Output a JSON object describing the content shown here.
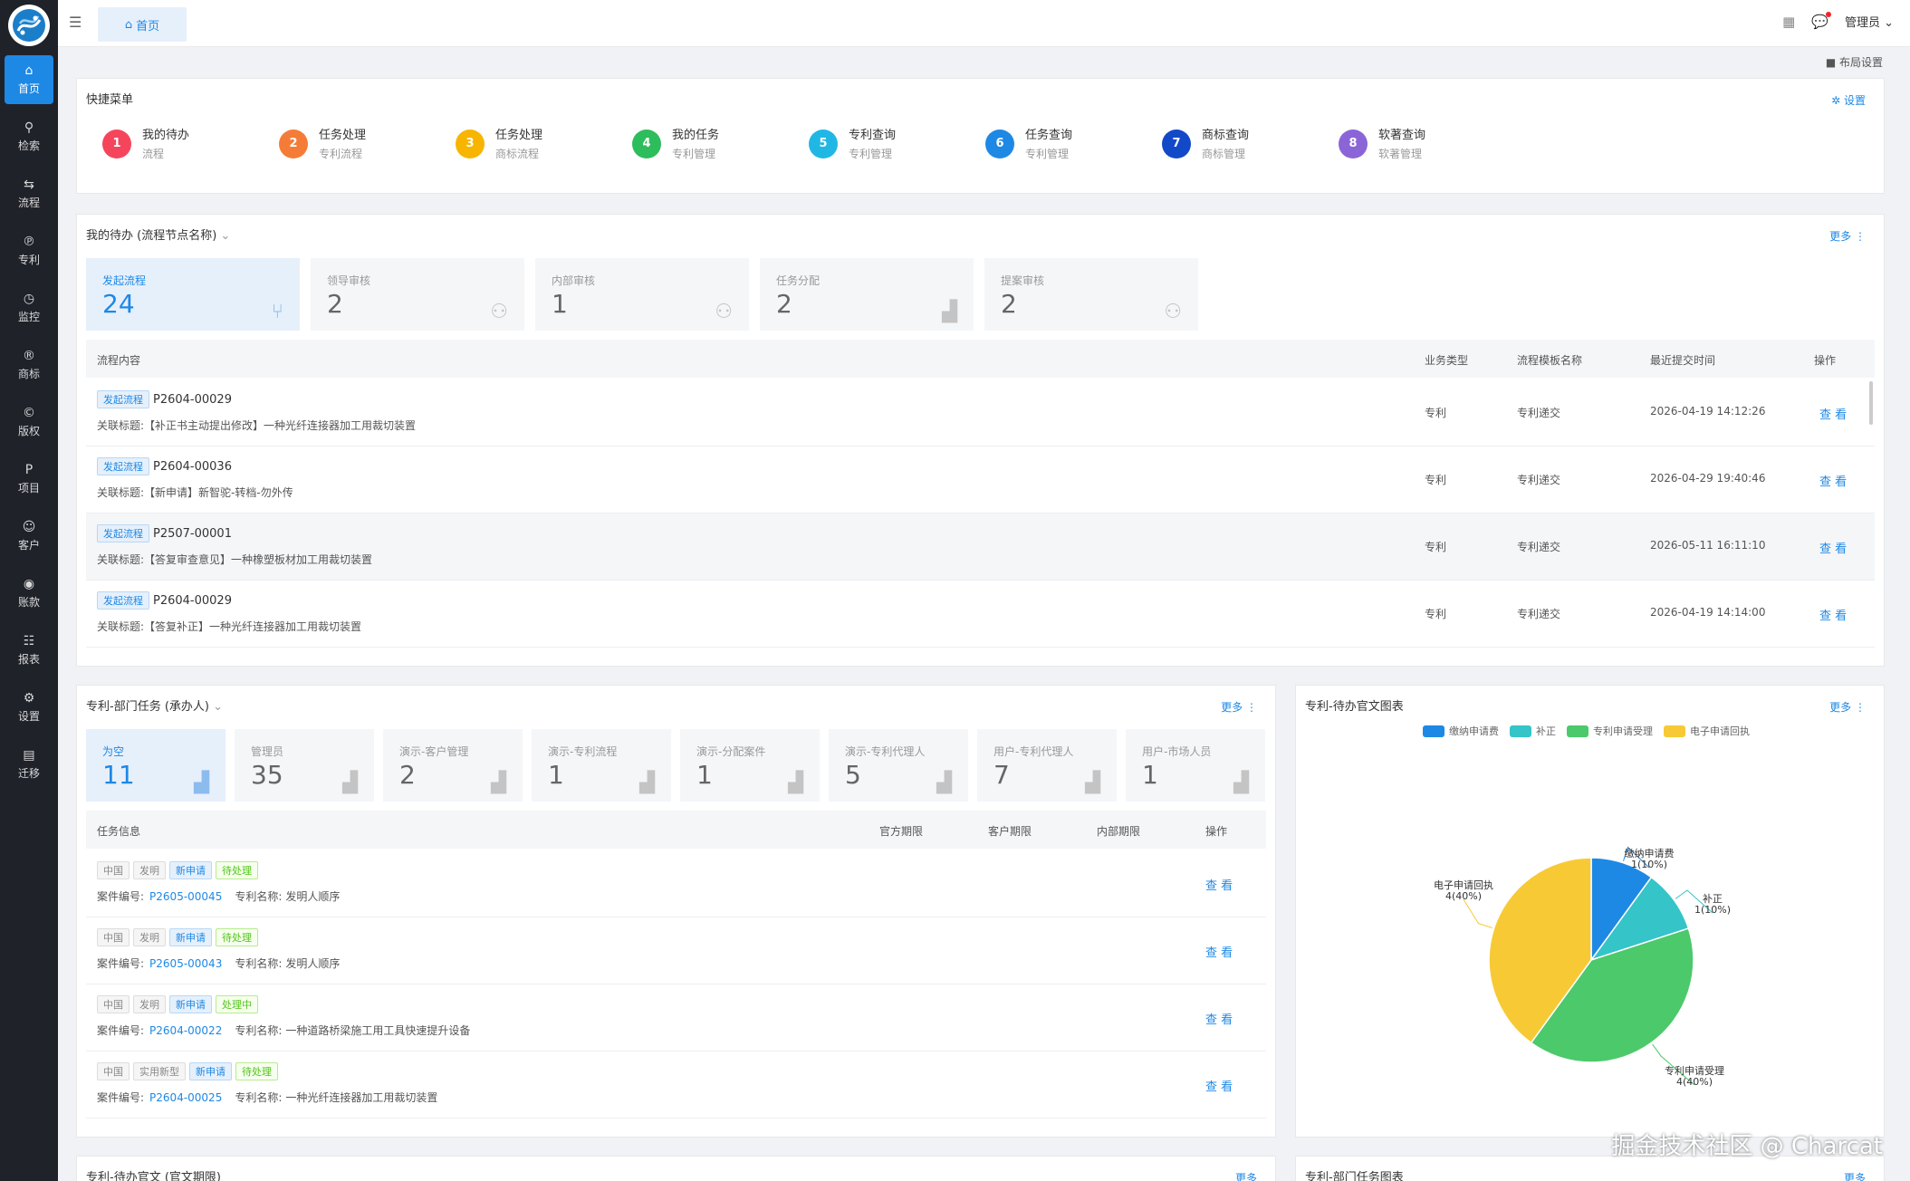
{
  "sidebar": {
    "items": [
      {
        "label": "首页",
        "icon": "home-icon"
      },
      {
        "label": "检索",
        "icon": "search-icon"
      },
      {
        "label": "流程",
        "icon": "flow-icon"
      },
      {
        "label": "专利",
        "icon": "patent-icon"
      },
      {
        "label": "监控",
        "icon": "clock-icon"
      },
      {
        "label": "商标",
        "icon": "trademark-icon"
      },
      {
        "label": "版权",
        "icon": "copyright-icon"
      },
      {
        "label": "项目",
        "icon": "project-icon"
      },
      {
        "label": "客户",
        "icon": "user-icon"
      },
      {
        "label": "账款",
        "icon": "money-icon"
      },
      {
        "label": "报表",
        "icon": "report-icon"
      },
      {
        "label": "设置",
        "icon": "gear-icon"
      },
      {
        "label": "迁移",
        "icon": "migrate-icon"
      }
    ]
  },
  "topbar": {
    "tab": "首页",
    "user": "管理员"
  },
  "layout_link": "布局设置",
  "quick": {
    "title": "快捷菜单",
    "settings": "设置",
    "items": [
      {
        "n": "1",
        "t": "我的待办",
        "s": "流程",
        "c": "#f5455c"
      },
      {
        "n": "2",
        "t": "任务处理",
        "s": "专利流程",
        "c": "#f57c37"
      },
      {
        "n": "3",
        "t": "任务处理",
        "s": "商标流程",
        "c": "#f7b500"
      },
      {
        "n": "4",
        "t": "我的任务",
        "s": "专利管理",
        "c": "#2dbd5c"
      },
      {
        "n": "5",
        "t": "专利查询",
        "s": "专利管理",
        "c": "#21b7e5"
      },
      {
        "n": "6",
        "t": "任务查询",
        "s": "专利管理",
        "c": "#1e88e5"
      },
      {
        "n": "7",
        "t": "商标查询",
        "s": "商标管理",
        "c": "#1249c9"
      },
      {
        "n": "8",
        "t": "软著查询",
        "s": "软著管理",
        "c": "#8b65d8"
      }
    ]
  },
  "todo": {
    "title": "我的待办 (流程节点名称)",
    "more": "更多",
    "stats": [
      {
        "l": "发起流程",
        "v": "24"
      },
      {
        "l": "领导审核",
        "v": "2"
      },
      {
        "l": "内部审核",
        "v": "1"
      },
      {
        "l": "任务分配",
        "v": "2"
      },
      {
        "l": "提案审核",
        "v": "2"
      }
    ],
    "headers": [
      "流程内容",
      "业务类型",
      "流程模板名称",
      "最近提交时间",
      "操作"
    ],
    "rows": [
      {
        "tag": "发起流程",
        "code": "P2604-00029",
        "label": "关联标题:",
        "title": "【补正书主动提出修改】一种光纤连接器加工用裁切装置",
        "type": "专利",
        "tpl": "专利递交",
        "time": "2026-04-19 14:12:26",
        "op": "查 看"
      },
      {
        "tag": "发起流程",
        "code": "P2604-00036",
        "label": "关联标题:",
        "title": "【新申请】新智驼-转档-勿外传",
        "type": "专利",
        "tpl": "专利递交",
        "time": "2026-04-29 19:40:46",
        "op": "查 看"
      },
      {
        "tag": "发起流程",
        "code": "P2507-00001",
        "label": "关联标题:",
        "title": "【答复审查意见】一种橡塑板材加工用裁切装置",
        "type": "专利",
        "tpl": "专利递交",
        "time": "2026-05-11 16:11:10",
        "op": "查 看"
      },
      {
        "tag": "发起流程",
        "code": "P2604-00029",
        "label": "关联标题:",
        "title": "【答复补正】一种光纤连接器加工用裁切装置",
        "type": "专利",
        "tpl": "专利递交",
        "time": "2026-04-19 14:14:00",
        "op": "查 看"
      }
    ]
  },
  "dept": {
    "title": "专利-部门任务 (承办人)",
    "more": "更多",
    "stats": [
      {
        "l": "为空",
        "v": "11"
      },
      {
        "l": "管理员",
        "v": "35"
      },
      {
        "l": "演示-客户管理",
        "v": "2"
      },
      {
        "l": "演示-专利流程",
        "v": "1"
      },
      {
        "l": "演示-分配案件",
        "v": "1"
      },
      {
        "l": "演示-专利代理人",
        "v": "5"
      },
      {
        "l": "用户-专利代理人",
        "v": "7"
      },
      {
        "l": "用户-市场人员",
        "v": "1"
      }
    ],
    "headers": [
      "任务信息",
      "官方期限",
      "客户期限",
      "内部期限",
      "操作"
    ],
    "case_label": "案件编号:",
    "name_label": "专利名称:",
    "rows": [
      {
        "tags": [
          "中国",
          "发明",
          "新申请",
          "待处理"
        ],
        "code": "P2605-00045",
        "name": "发明人顺序",
        "op": "查 看"
      },
      {
        "tags": [
          "中国",
          "发明",
          "新申请",
          "待处理"
        ],
        "code": "P2605-00043",
        "name": "发明人顺序",
        "op": "查 看"
      },
      {
        "tags": [
          "中国",
          "发明",
          "新申请",
          "处理中"
        ],
        "code": "P2604-00022",
        "name": "一种道路桥梁施工用工具快速提升设备",
        "op": "查 看"
      },
      {
        "tags": [
          "中国",
          "实用新型",
          "新申请",
          "待处理"
        ],
        "code": "P2604-00025",
        "name": "一种光纤连接器加工用裁切装置",
        "op": "查 看"
      }
    ]
  },
  "pie_card": {
    "title": "专利-待办官文图表",
    "more": "更多"
  },
  "chart_data": {
    "type": "pie",
    "title": "",
    "slices": [
      {
        "name": "缴纳申请费",
        "value": 1,
        "label": "1(10%)",
        "color": "#1e88e5"
      },
      {
        "name": "补正",
        "value": 1,
        "label": "1(10%)",
        "color": "#35c4c8"
      },
      {
        "name": "专利申请受理",
        "value": 4,
        "label": "4(40%)",
        "color": "#4cc96b"
      },
      {
        "name": "电子申请回执",
        "value": 4,
        "label": "4(40%)",
        "color": "#f7ca35"
      }
    ],
    "legend": "top"
  },
  "bottom": {
    "left_title": "专利-待办官文 (官文期限)",
    "left_more": "更多",
    "right_title": "专利-部门任务图表",
    "right_more": "更多"
  },
  "watermark": "掘金技术社区 @ Charcat"
}
